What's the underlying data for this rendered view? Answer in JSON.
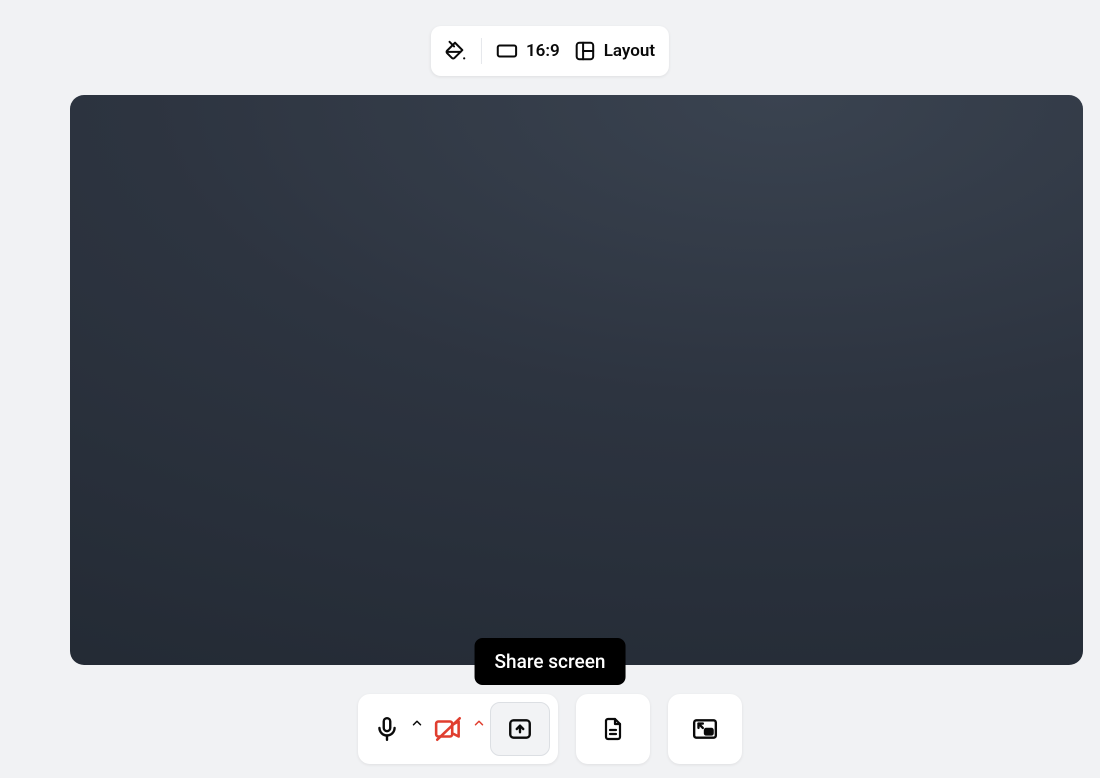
{
  "top_toolbar": {
    "background_label": "Background",
    "aspect_label": "16:9",
    "layout_label": "Layout"
  },
  "tooltip": {
    "share_screen": "Share screen"
  },
  "controls": {
    "mic": "Microphone",
    "camera": "Camera (off)",
    "share": "Share screen",
    "notes": "Notes",
    "pip": "Picture in picture"
  },
  "colors": {
    "danger": "#e03e2f",
    "text": "#0a0a0a"
  }
}
